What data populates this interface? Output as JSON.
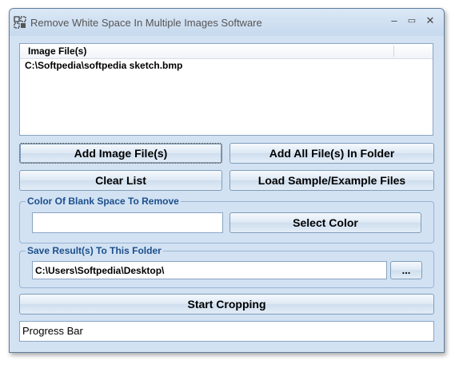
{
  "window": {
    "title": "Remove White Space In Multiple Images Software",
    "minimize_glyph": "–",
    "maximize_glyph": "▭",
    "close_glyph": "✕"
  },
  "file_list": {
    "column_header": "Image File(s)",
    "items": [
      "C:\\Softpedia\\softpedia sketch.bmp"
    ]
  },
  "buttons": {
    "add_image_files": "Add Image File(s)",
    "add_all_in_folder": "Add All File(s) In Folder",
    "clear_list": "Clear List",
    "load_sample": "Load Sample/Example Files",
    "select_color": "Select Color",
    "browse": "...",
    "start_cropping": "Start Cropping"
  },
  "color_group": {
    "label": "Color Of Blank Space To Remove",
    "value": ""
  },
  "save_group": {
    "label": "Save Result(s) To This Folder",
    "value": "C:\\Users\\Softpedia\\Desktop\\"
  },
  "progress": {
    "label": "Progress Bar"
  },
  "icons": {
    "app_icon": "grid-scissors-icon"
  }
}
